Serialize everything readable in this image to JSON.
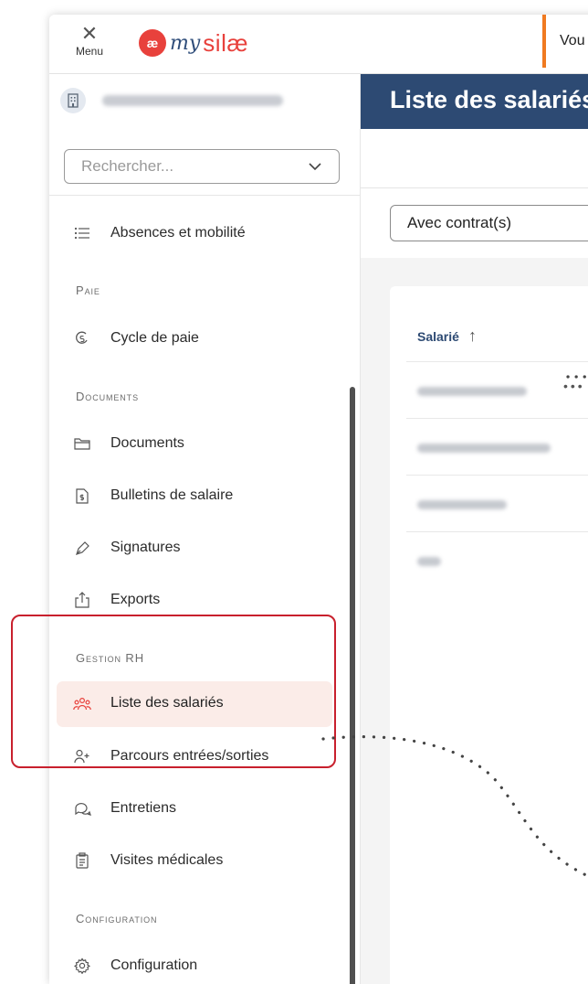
{
  "topbar": {
    "menu_label": "Menu",
    "logo": {
      "badge": "æ",
      "my": "my",
      "brand": "silæ",
      "brand_color": "#e8413c",
      "my_color": "#2f4d7a"
    },
    "message_partial": "Vou",
    "accent_color": "#f07a20"
  },
  "sidebar": {
    "company_icon": "building-icon",
    "search_placeholder": "Rechercher...",
    "items_top": [
      {
        "label": "Absences et mobilité",
        "icon": "list-icon"
      }
    ],
    "sections": {
      "paie": "Paie",
      "documents": "Documents",
      "gestion_rh": "Gestion RH",
      "configuration": "Configuration"
    },
    "paie_items": [
      {
        "label": "Cycle de paie",
        "icon": "cycle-icon"
      }
    ],
    "documents_items": [
      {
        "label": "Documents",
        "icon": "folder-icon"
      },
      {
        "label": "Bulletins de salaire",
        "icon": "payslip-icon"
      },
      {
        "label": "Signatures",
        "icon": "pen-icon"
      },
      {
        "label": "Exports",
        "icon": "export-icon"
      }
    ],
    "rh_items": [
      {
        "label": "Liste des salariés",
        "icon": "users-icon",
        "active": true
      },
      {
        "label": "Parcours entrées/sorties",
        "icon": "user-plus-icon"
      },
      {
        "label": "Entretiens",
        "icon": "chat-icon"
      },
      {
        "label": "Visites médicales",
        "icon": "clipboard-icon"
      }
    ],
    "config_items": [
      {
        "label": "Configuration",
        "icon": "gear-icon"
      }
    ],
    "highlight_color": "#c8202d",
    "active_bg": "#fbece8"
  },
  "main": {
    "title": "Liste des salariés",
    "header_color": "#2d4a73",
    "filter_value": "Avec contrat(s)",
    "table": {
      "column_header": "Salarié",
      "sort": "ascending"
    }
  }
}
